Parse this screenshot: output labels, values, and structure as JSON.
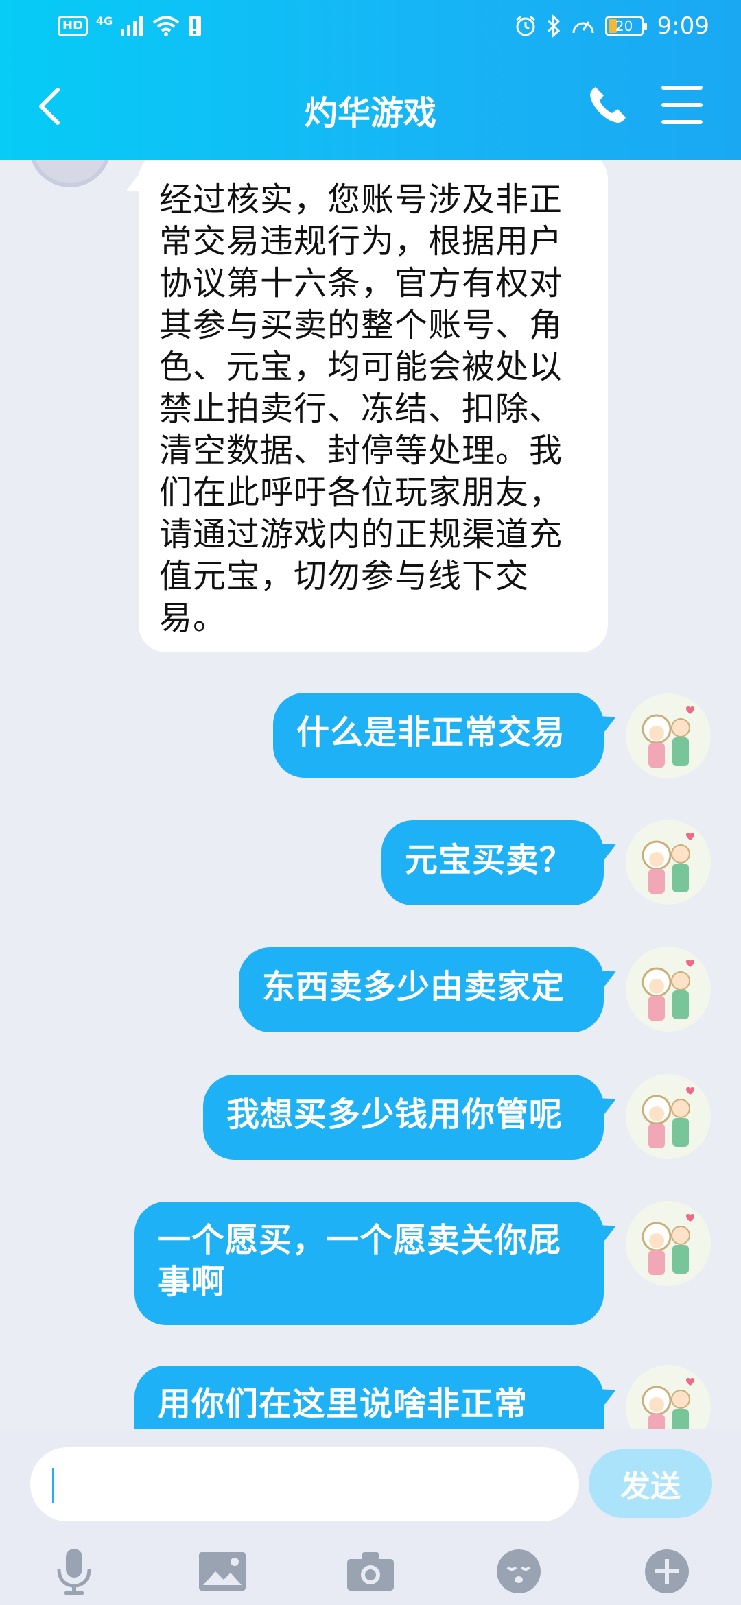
{
  "status_bar": {
    "hd": "HD",
    "network": "4G",
    "battery_level": "20",
    "time": "9:09"
  },
  "header": {
    "title": "灼华游戏"
  },
  "messages": [
    {
      "from": "other",
      "text": "经过核实，您账号涉及非正常交易违规行为，根据用户协议第十六条，官方有权对其参与买卖的整个账号、角色、元宝，均可能会被处以禁止拍卖行、冻结、扣除、清空数据、封停等处理。我们在此呼吁各位玩家朋友，请通过游戏内的正规渠道充值元宝，切勿参与线下交易。"
    },
    {
      "from": "me",
      "text": "什么是非正常交易"
    },
    {
      "from": "me",
      "text": "元宝买卖？"
    },
    {
      "from": "me",
      "text": "东西卖多少由卖家定"
    },
    {
      "from": "me",
      "text": "我想买多少钱用你管呢"
    },
    {
      "from": "me",
      "text": "一个愿买，一个愿卖关你屁事啊"
    },
    {
      "from": "me",
      "text": "用你们在这里说啥非正常"
    }
  ],
  "input": {
    "value": "",
    "send_label": "发送"
  },
  "toolbar": {
    "icons": [
      "microphone-icon",
      "image-icon",
      "camera-icon",
      "emoji-icon",
      "plus-icon"
    ]
  },
  "colors": {
    "header_start": "#06ccf6",
    "header_end": "#1aa8f3",
    "outgoing_bubble": "#1fb1f6",
    "send_button": "#abe3fb",
    "background": "#eaedf4"
  }
}
